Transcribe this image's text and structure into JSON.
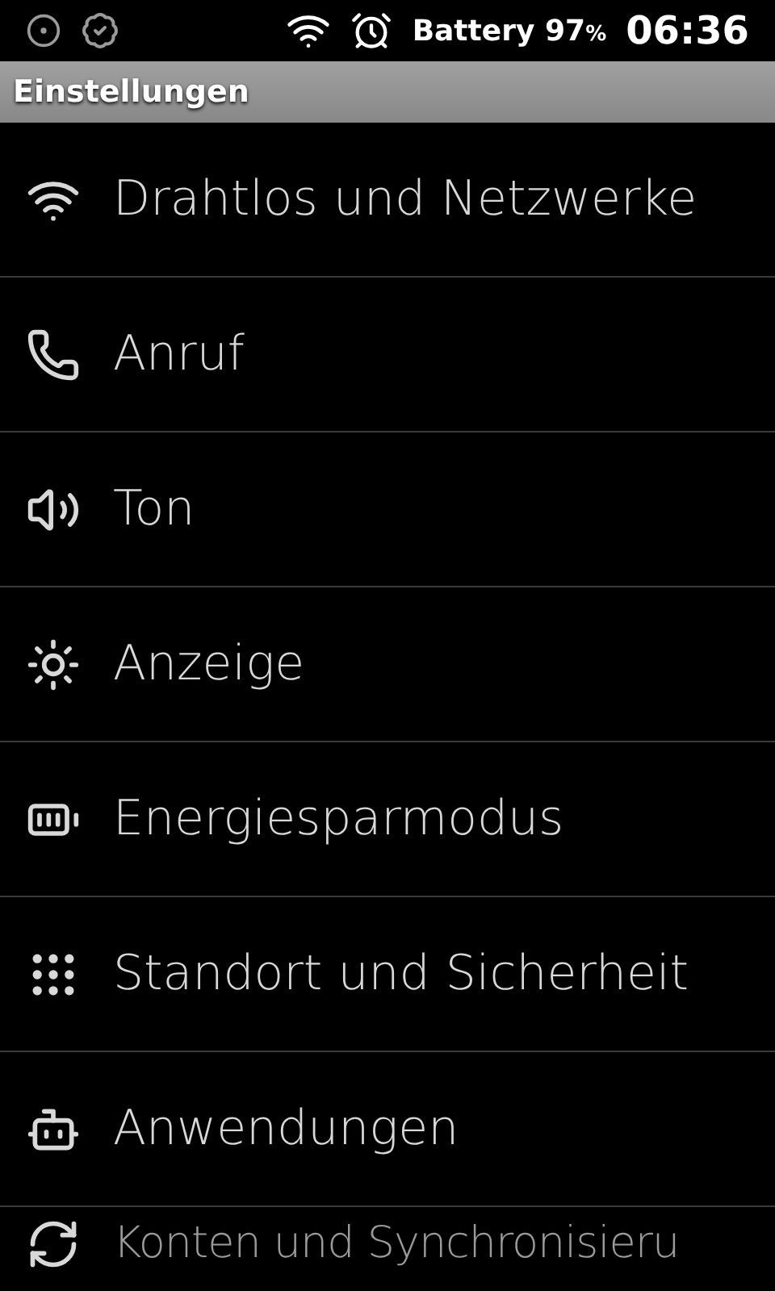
{
  "status_bar": {
    "battery_label": "Battery",
    "battery_value": "97",
    "battery_unit": "%",
    "time": "06:36"
  },
  "title_bar": {
    "title": "Einstellungen"
  },
  "settings": [
    {
      "label": "Drahtlos und Netzwerke"
    },
    {
      "label": "Anruf"
    },
    {
      "label": "Ton"
    },
    {
      "label": "Anzeige"
    },
    {
      "label": "Energiesparmodus"
    },
    {
      "label": "Standort und Sicherheit"
    },
    {
      "label": "Anwendungen"
    },
    {
      "label": "Konten und Synchronisieru"
    }
  ]
}
